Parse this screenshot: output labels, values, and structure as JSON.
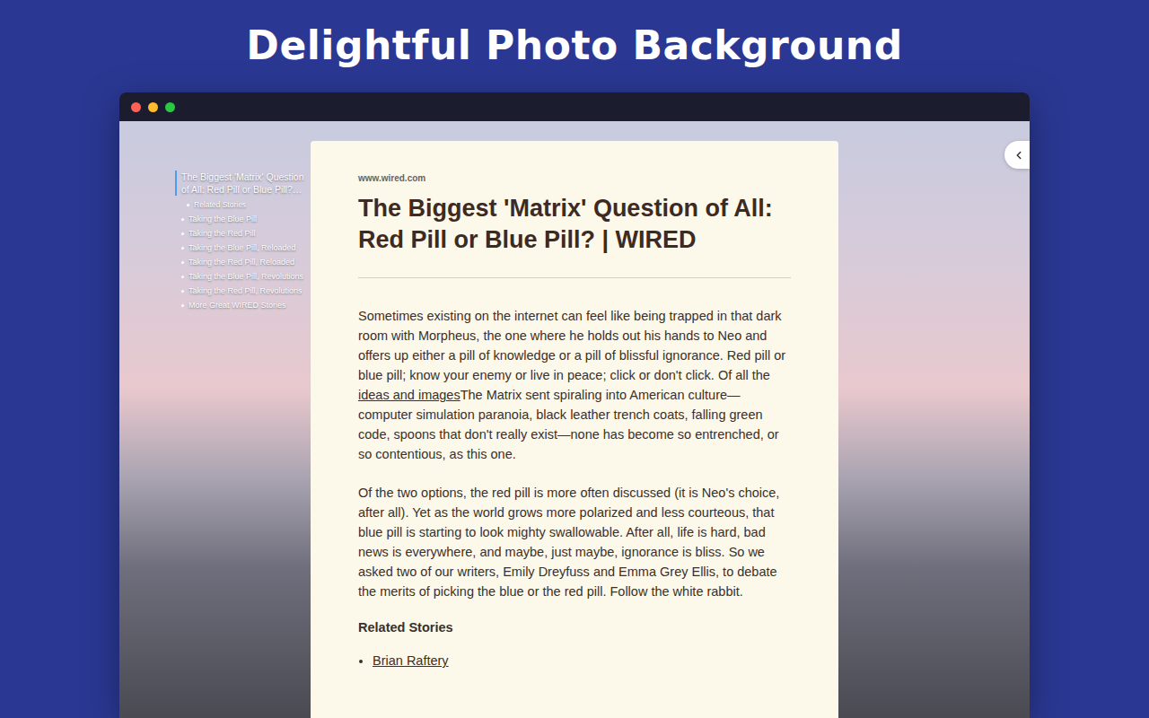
{
  "banner": {
    "title": "Delightful Photo Background"
  },
  "toc": [
    {
      "label": "The Biggest 'Matrix' Question of All: Red Pill or Blue Pill?…",
      "kind": "title",
      "selected": true
    },
    {
      "label": "Related Stories",
      "kind": "sub",
      "selected": false
    },
    {
      "label": "Taking the Blue Pill",
      "kind": "item",
      "selected": false
    },
    {
      "label": "Taking the Red Pill",
      "kind": "item",
      "selected": false
    },
    {
      "label": "Taking the Blue Pill, Reloaded",
      "kind": "item",
      "selected": false
    },
    {
      "label": "Taking the Red Pill, Reloaded",
      "kind": "item",
      "selected": false
    },
    {
      "label": "Taking the Blue Pill, Revolutions",
      "kind": "item",
      "selected": false
    },
    {
      "label": "Taking the Red Pill, Revolutions",
      "kind": "item",
      "selected": false
    },
    {
      "label": "More Great WIRED Stories",
      "kind": "item",
      "selected": false
    }
  ],
  "article": {
    "source": "www.wired.com",
    "title": "The Biggest 'Matrix' Question of All: Red Pill or Blue Pill? | WIRED",
    "paragraphs": [
      [
        {
          "text": "Sometimes existing on the internet can feel like being trapped in that dark room with Morpheus, the one where he holds out his hands to Neo and offers up either a pill of knowledge or a pill of blissful ignorance. Red pill or blue pill; know your enemy or live in peace; click or don't click. Of all the ",
          "link": false
        },
        {
          "text": "ideas and images",
          "link": true
        },
        {
          "text": "The Matrix sent spiraling into American culture—computer simulation paranoia, black leather trench coats, falling green code, spoons that don't really exist—none has become so entrenched, or so contentious, as this one.",
          "link": false
        }
      ],
      [
        {
          "text": "Of the two options, the red pill is more often discussed (it is Neo's choice, after all). Yet as the world grows more polarized and less courteous, that blue pill is starting to look mighty swallowable. After all, life is hard, bad news is everywhere, and maybe, just maybe, ignorance is bliss. So we asked two of our writers, Emily Dreyfuss and Emma Grey Ellis, to debate the merits of picking the blue or the red pill. Follow the white rabbit.",
          "link": false
        }
      ]
    ],
    "section": "Related Stories",
    "links": [
      "Brian Raftery"
    ]
  }
}
